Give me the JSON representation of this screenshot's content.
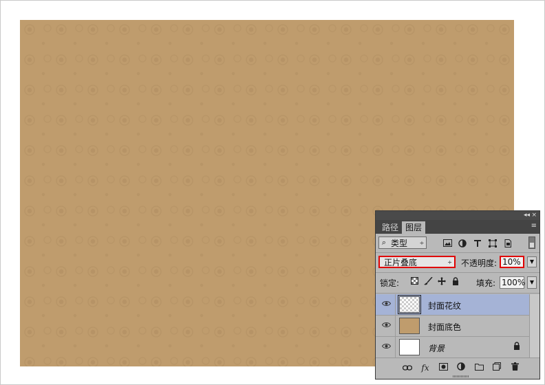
{
  "panel": {
    "collapse_icon": "◂◂",
    "close_icon": "×",
    "tabs": [
      {
        "label": "路径",
        "active": false
      },
      {
        "label": "图层",
        "active": true
      }
    ],
    "menu_icon": "≡",
    "filter": {
      "label": "类型",
      "search_icon": "⌕",
      "arrow": "÷"
    },
    "filter_icons": [
      "image-filter-icon",
      "adjustment-filter-icon",
      "type-filter-icon",
      "shape-filter-icon",
      "smart-object-filter-icon"
    ],
    "blend_mode": "正片叠底",
    "opacity_label": "不透明度:",
    "opacity_value": "10%",
    "lock_label": "锁定:",
    "fill_label": "填充:",
    "fill_value": "100%",
    "layers": [
      {
        "name": "封面花纹",
        "selected": true,
        "thumb": "checker"
      },
      {
        "name": "封面底色",
        "selected": false,
        "thumb": "tan"
      },
      {
        "name": "背景",
        "selected": false,
        "thumb": "white",
        "locked": true
      }
    ],
    "colors": {
      "accent_highlight": "#e00000",
      "selected_layer": "#a5b3d6",
      "canvas": "#bf9c6d"
    }
  }
}
